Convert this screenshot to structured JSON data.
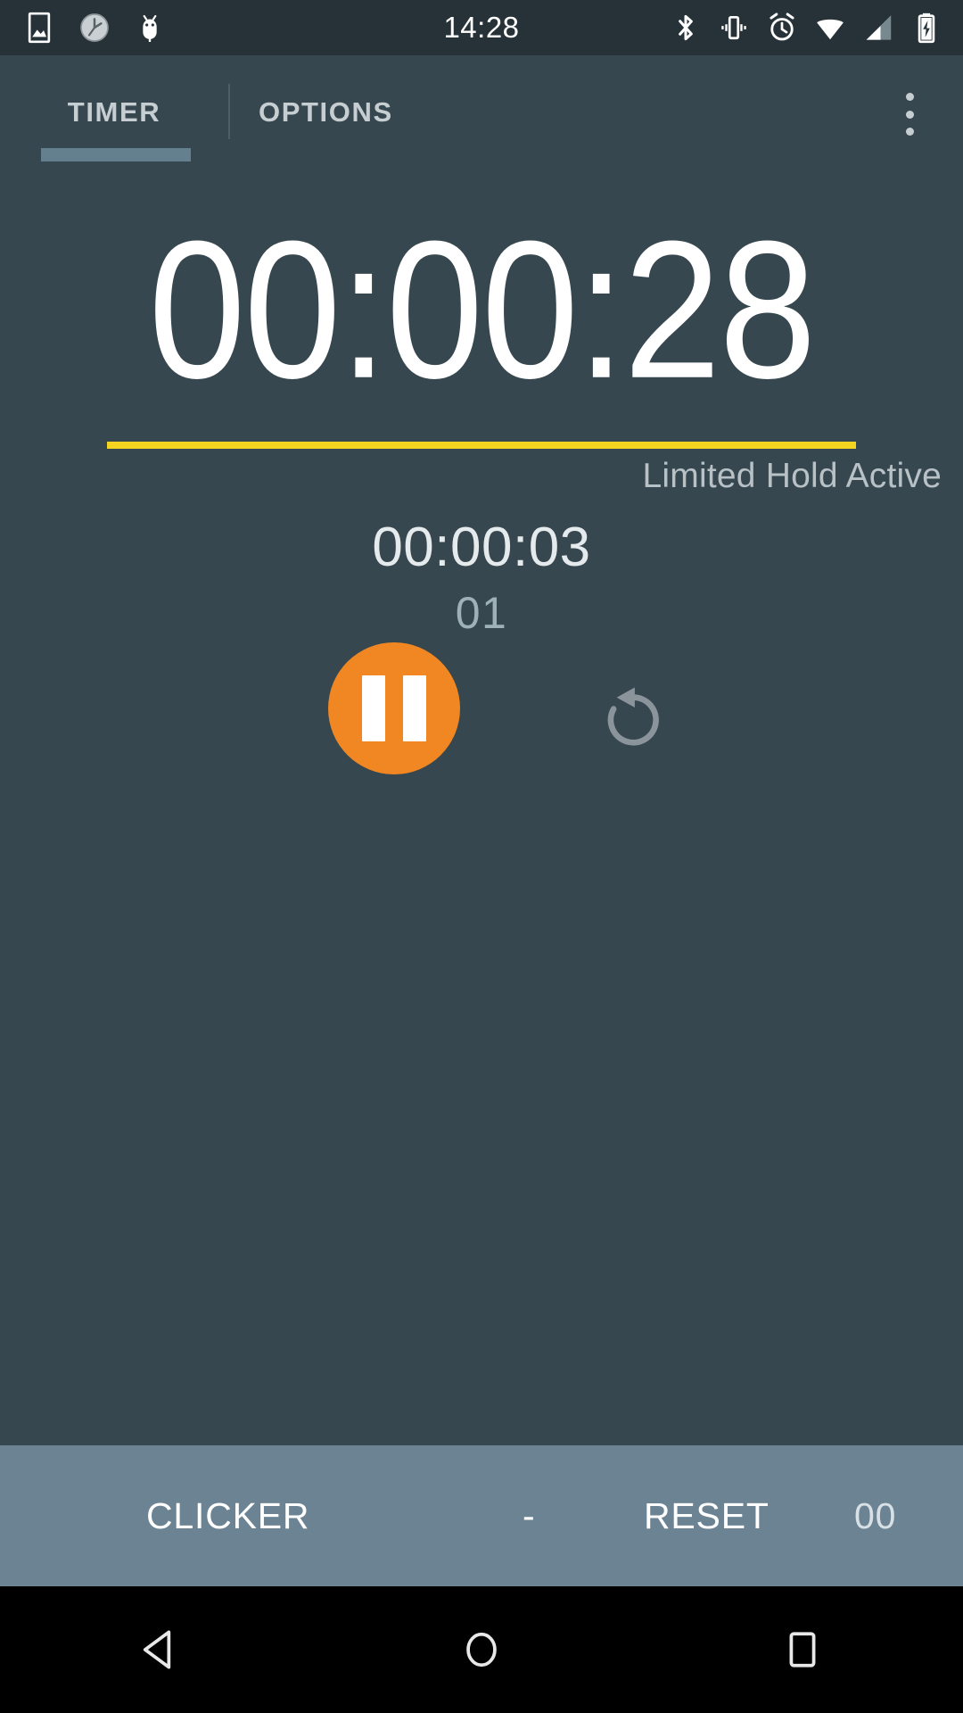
{
  "status_bar": {
    "clock": "14:28",
    "left_icons": [
      "image-icon",
      "clock-icon",
      "android-bug-icon"
    ],
    "right_icons": [
      "bluetooth-icon",
      "vibrate-icon",
      "alarm-icon",
      "wifi-icon",
      "cell-signal-icon",
      "battery-charging-icon"
    ],
    "background_color": "#263238"
  },
  "tabs": {
    "items": [
      {
        "label": "TIMER",
        "active": true
      },
      {
        "label": "OPTIONS",
        "active": false
      }
    ],
    "overflow_label": "overflow-menu",
    "indicator_color": "#64808F"
  },
  "timer": {
    "primary": "00:00:28",
    "secondary": "00:00:03",
    "lap_count": "01",
    "hold_status": "Limited Hold Active",
    "progress_color": "#F3D420",
    "accent_color": "#F08722",
    "background_color": "#37474F"
  },
  "controls": {
    "pause_label": "pause-button",
    "reset_label": "reset-button"
  },
  "bottom_bar": {
    "clicker_label": "CLICKER",
    "separator": "-",
    "reset_label": "RESET",
    "count": "00",
    "background_color": "#6B8393"
  },
  "nav_bar": {
    "back_label": "back-nav-button",
    "home_label": "home-nav-button",
    "recents_label": "recents-nav-button"
  }
}
